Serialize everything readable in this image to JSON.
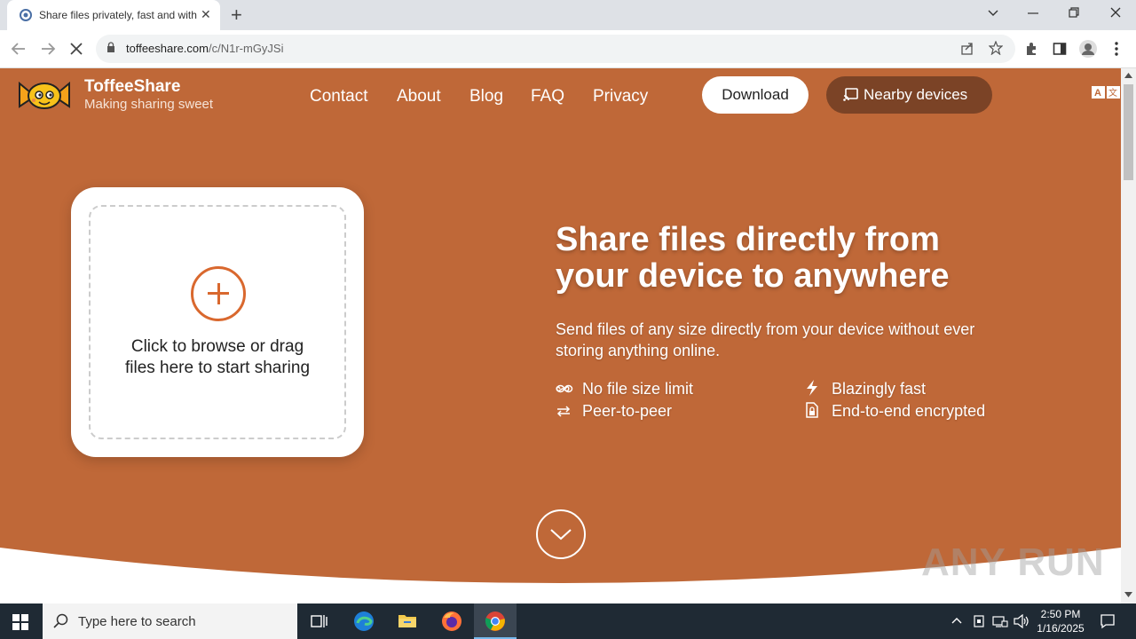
{
  "browser": {
    "tab_title": "Share files privately, fast and with",
    "url_host": "toffeeshare.com",
    "url_path": "/c/N1r-mGyJSi"
  },
  "site": {
    "brand_name": "ToffeeShare",
    "tagline": "Making sharing sweet",
    "nav": [
      "Contact",
      "About",
      "Blog",
      "FAQ",
      "Privacy"
    ],
    "download_label": "Download",
    "nearby_label": "Nearby devices",
    "accent_color": "#bf6838",
    "dark_button_color": "#7b4326",
    "plus_color": "#d9682e"
  },
  "upload": {
    "line1": "Click to browse or drag",
    "line2": "files here to start sharing"
  },
  "hero": {
    "headline_line1": "Share files directly from",
    "headline_line2": "your device to anywhere",
    "subtext": "Send files of any size directly from your device without ever storing anything online.",
    "features": [
      {
        "icon": "infinity-icon",
        "label": "No file size limit"
      },
      {
        "icon": "lightning-icon",
        "label": "Blazingly fast"
      },
      {
        "icon": "swap-arrows-icon",
        "label": "Peer-to-peer"
      },
      {
        "icon": "locked-file-icon",
        "label": "End-to-end encrypted"
      }
    ]
  },
  "watermark": "ANY RUN",
  "taskbar": {
    "search_placeholder": "Type here to search",
    "time": "2:50 PM",
    "date": "1/16/2025"
  }
}
